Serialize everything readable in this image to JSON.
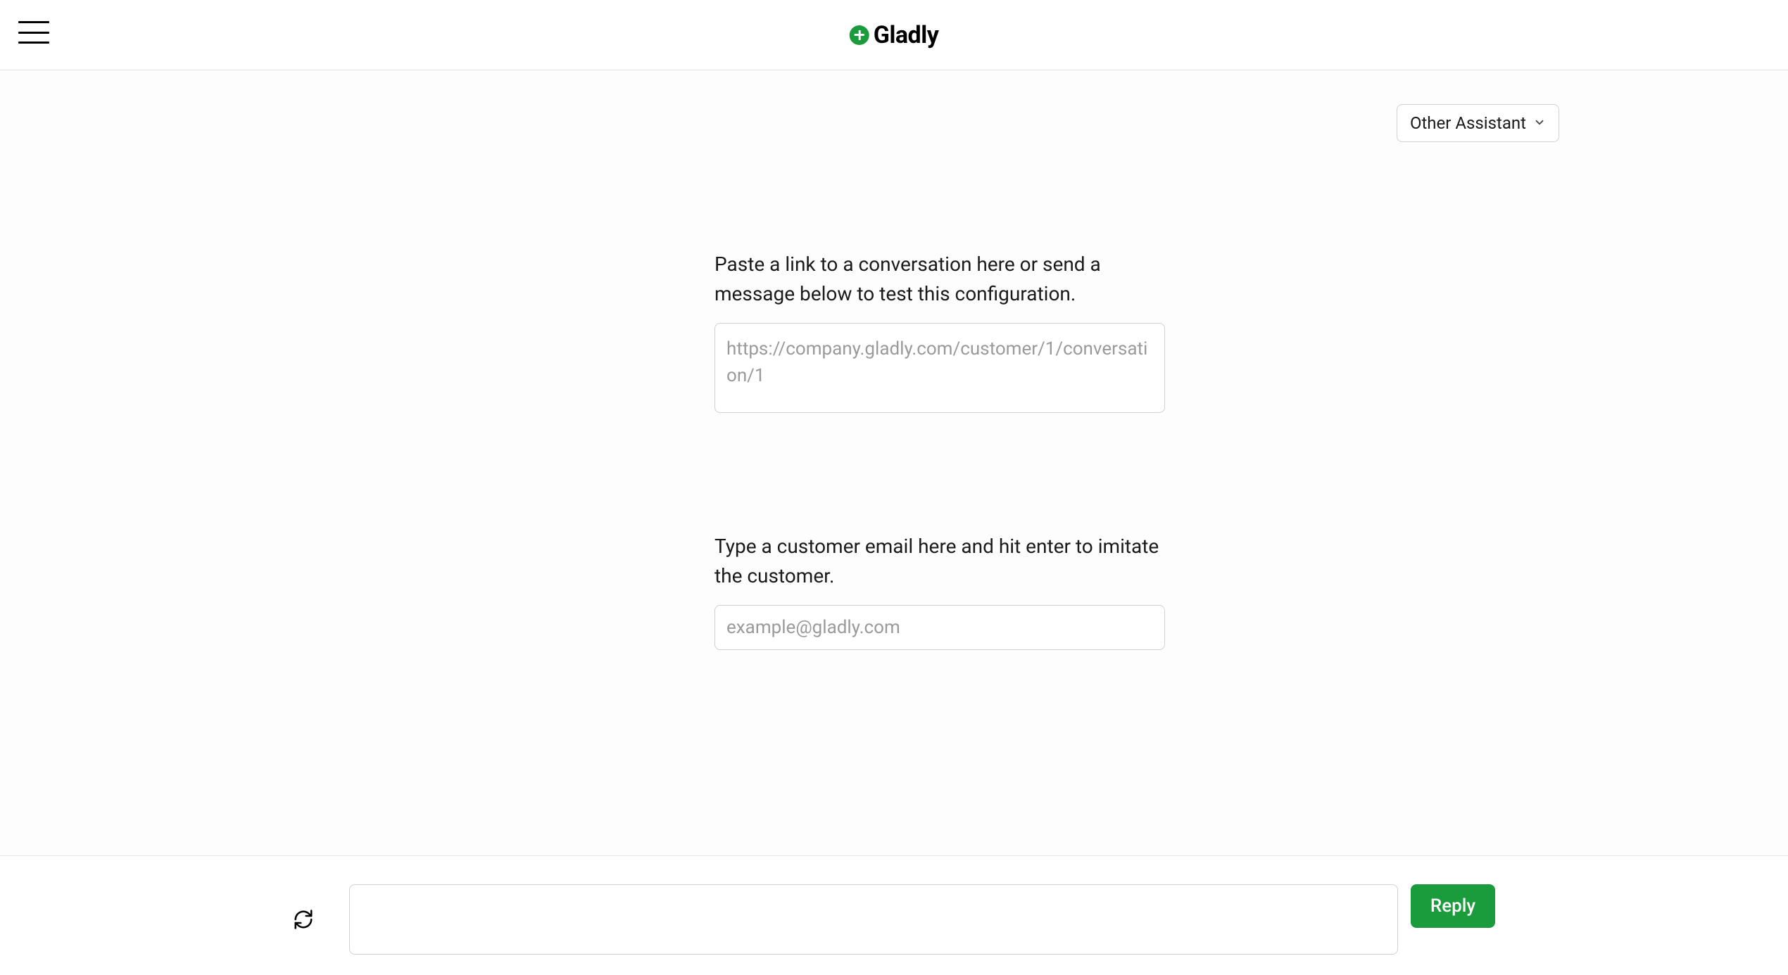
{
  "header": {
    "brand": "Gladly"
  },
  "dropdown": {
    "selected": "Other Assistant"
  },
  "form": {
    "link_label": "Paste a link to a conversation here or send a message below to test this configuration.",
    "link_placeholder": "https://company.gladly.com/customer/1/conversation/1",
    "email_label": "Type a customer email here and hit enter to imitate the customer.",
    "email_placeholder": "example@gladly.com"
  },
  "footer": {
    "message_value": "",
    "reply_label": "Reply"
  }
}
